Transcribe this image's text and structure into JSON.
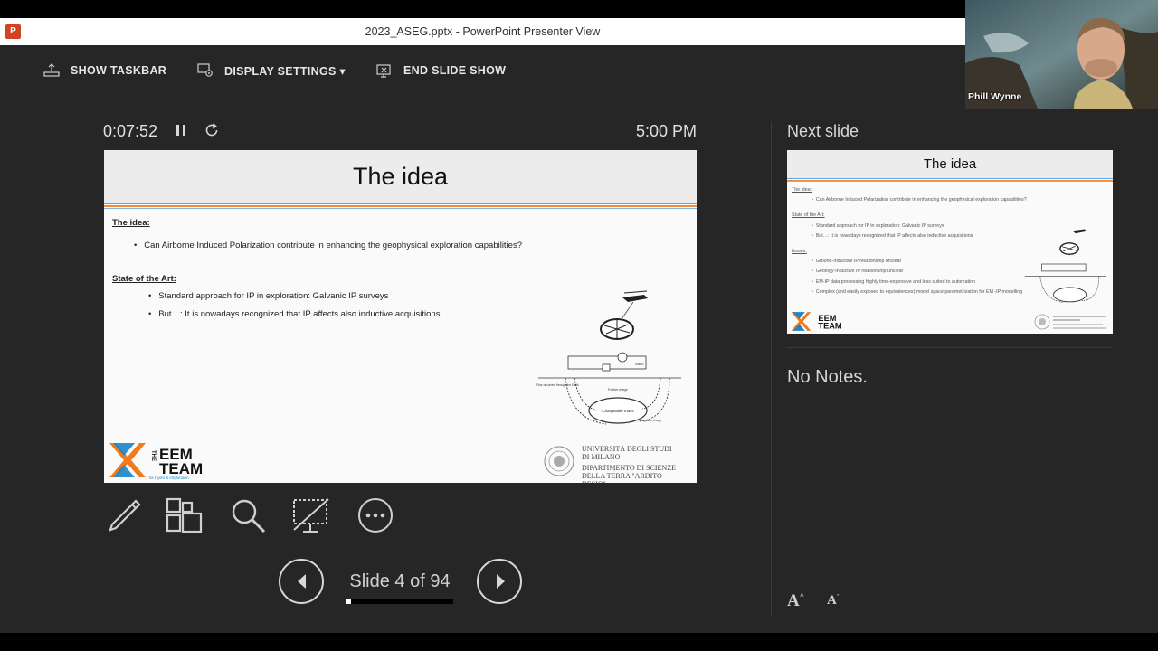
{
  "window": {
    "title": "2023_ASEG.pptx - PowerPoint Presenter View",
    "app_icon": "powerpoint-icon",
    "app_icon_letter": "P"
  },
  "toolbar": {
    "show_taskbar": "SHOW TASKBAR",
    "display_settings": "DISPLAY SETTINGS ▾",
    "end_slide_show": "END SLIDE SHOW"
  },
  "timer": {
    "elapsed": "0:07:52",
    "clock": "5:00 PM"
  },
  "current_slide": {
    "title": "The idea",
    "section1_heading": "The idea:",
    "section1_bullets": [
      "Can Airborne Induced Polarization contribute in enhancing the geophysical exploration capabilities?"
    ],
    "section2_heading": "State of the Art:",
    "section2_bullets": [
      "Standard approach for IP in exploration: Galvanic IP surveys",
      "But…: It is nowadays recognized that IP affects also inductive acquisitions"
    ],
    "logo_text": [
      "THE",
      "EEM",
      "TEAM",
      "for Hydro & eXploration"
    ],
    "university": [
      "UNIVERSITÀ DEGLI STUDI",
      "DI MILANO",
      "DIPARTIMENTO DI SCIENZE",
      "DELLA TERRA \"ARDITO DESIO\""
    ],
    "diagram_labels": {
      "mass": "Chargeable mass",
      "positive": "Positive charge",
      "negative": "Negative charge",
      "flow": "Flow of current through the Earth",
      "switch": "Switch"
    }
  },
  "slide_tools": [
    {
      "name": "pen-tool-icon"
    },
    {
      "name": "see-all-slides-icon"
    },
    {
      "name": "zoom-icon"
    },
    {
      "name": "black-screen-icon"
    },
    {
      "name": "more-options-icon"
    }
  ],
  "navigation": {
    "counter": "Slide 4 of 94",
    "current": 4,
    "total": 94,
    "progress_fraction": 0.043
  },
  "next_slide": {
    "label": "Next slide",
    "title": "The idea",
    "section1_heading": "The idea:",
    "section1_bullets": [
      "Can Airborne Induced Polarization contribute in enhancing the geophysical exploration capabilities?"
    ],
    "section2_heading": "State of the Art:",
    "section2_bullets": [
      "Standard approach for IP in exploration: Galvanic IP surveys",
      "But…: It is nowadays recognized that IP affects also inductive acquisitions"
    ],
    "section3_heading": "Issues:",
    "section3_bullets": [
      "Ground-Inductive IP relationship unclear",
      "Geology-Inductive IP relationship unclear",
      "EM-IP data processing highly time-expensive and less suited to automation",
      "Complex (and easily exposed to equivalences) model space parametrization for EM -IP modelling"
    ]
  },
  "notes": {
    "text": "No Notes."
  },
  "font_controls": {
    "increase": "A",
    "decrease": "A"
  },
  "webcam": {
    "name": "Phill Wynne"
  },
  "colors": {
    "background": "#262626",
    "accent_blue": "#5aa7e0",
    "accent_orange": "#f08a3c",
    "ppt_red": "#d04423"
  }
}
